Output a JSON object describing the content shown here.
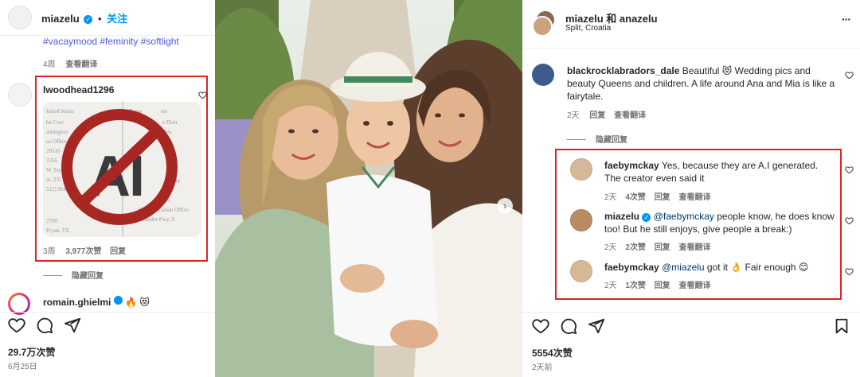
{
  "left": {
    "header": {
      "username": "miazelu",
      "dot": "•",
      "follow": "关注"
    },
    "hashtags": "#vacaymood #feminity #softlight",
    "caption_meta": {
      "time": "4周",
      "translate": "查看翻译"
    },
    "comment1": {
      "username": "lwoodhead1296",
      "image_text": "AI",
      "meta": {
        "time": "3周",
        "likes": "3,977次赞",
        "reply": "回复"
      }
    },
    "hidden_replies": "隐藏回复",
    "comment2": {
      "username": "romain.ghielmi",
      "emojis": "🔥 😻"
    },
    "likes": "29.7万次赞",
    "date": "6月25日"
  },
  "right": {
    "header": {
      "title": "miazelu 和 anazelu",
      "location": "Split, Croatia",
      "more": "···"
    },
    "comment_main": {
      "username": "blackrocklabradors_dale",
      "text": "Beautiful 😻 Wedding pics and beauty Queens and children. A life around Ana and Mia is like a fairytale.",
      "meta": {
        "time": "2天",
        "reply": "回复",
        "translate": "查看翻译"
      }
    },
    "hidden_replies": "隐藏回复",
    "replies": [
      {
        "username": "faebymckay",
        "text": "Yes, because they are A.I generated. The creator even said it",
        "meta": {
          "time": "2天",
          "likes": "4次赞",
          "reply": "回复",
          "translate": "查看翻译"
        }
      },
      {
        "username": "miazelu",
        "mention": "@faebymckay",
        "text": " people know, he does know too! But he still enjoys, give people a break:)",
        "meta": {
          "time": "2天",
          "likes": "2次赞",
          "reply": "回复",
          "translate": "查看翻译"
        }
      },
      {
        "username": "faebymckay",
        "mention": "@miazelu",
        "text": " got it 👌 Fair enough 😊",
        "meta": {
          "time": "2天",
          "likes": "1次赞",
          "reply": "回复",
          "translate": "查看翻译"
        }
      }
    ],
    "likes": "5554次赞",
    "date": "2天前"
  },
  "colors": {
    "accent": "#0095f6",
    "hashtag": "#4a5bd6",
    "highlight": "#e0231f",
    "muted": "#737373",
    "mention": "#00376b"
  },
  "icons": [
    "heart-icon",
    "comment-icon",
    "share-icon",
    "bookmark-icon",
    "verified-icon",
    "carousel-next-icon",
    "more-icon"
  ]
}
